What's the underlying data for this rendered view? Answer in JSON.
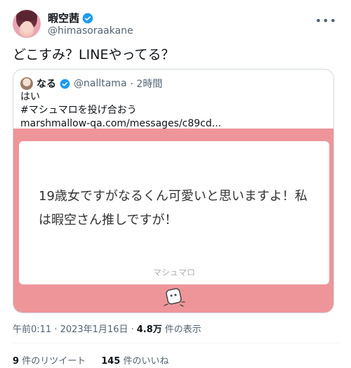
{
  "author": {
    "display_name": "暇空茜",
    "handle": "@himasoraakane"
  },
  "tweet": {
    "text": "どこすみ？LINEやってる？"
  },
  "quoted": {
    "display_name": "なる",
    "handle": "@nalltama",
    "time": "· 2時間",
    "line1": "はい",
    "line2": "#マシュマロを投げ合おう",
    "link": "marshmallow-qa.com/messages/c89cd...",
    "card_text": "19歳女ですがなるくん可愛いと思いますよ！私は暇空さん推しですが！",
    "card_footer": "マシュマロ"
  },
  "meta": {
    "time": "午前0:11 · 2023年1月16日 ·",
    "views_count": "4.8万",
    "views_label": "件の表示"
  },
  "stats": {
    "retweets_count": "9",
    "retweets_label": "件のリツイート",
    "likes_count": "145",
    "likes_label": "件のいいね"
  },
  "colors": {
    "verified": "#1d9bf0",
    "card_background": "#ee959a"
  },
  "icons": {
    "more": "more-horizontal-icon",
    "verified": "verified-badge-icon",
    "mascot": "marshmallow-mascot-icon"
  }
}
